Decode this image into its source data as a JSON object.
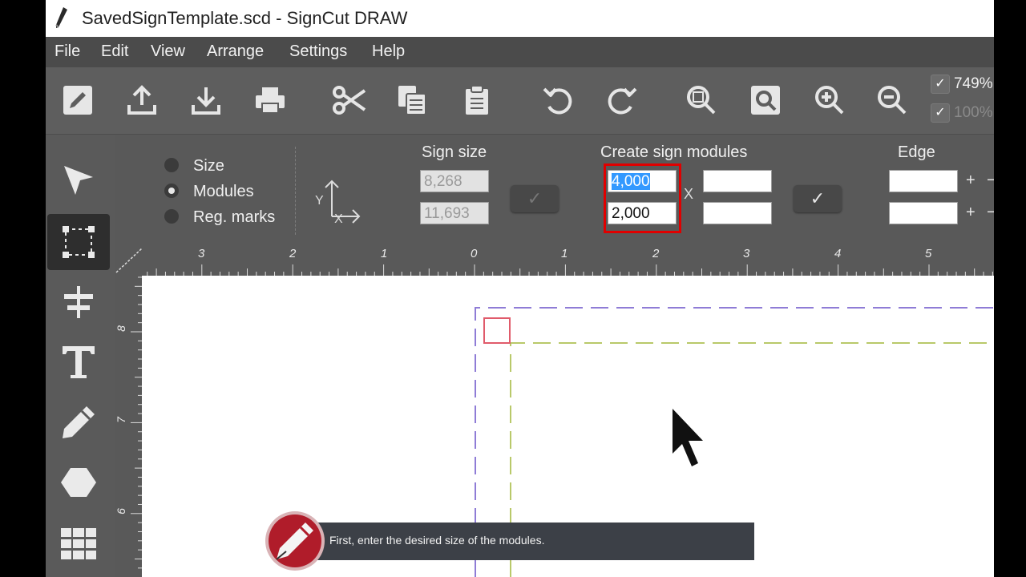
{
  "window": {
    "title": "SavedSignTemplate.scd - SignCut DRAW",
    "app_icon": "pen-icon"
  },
  "menu": [
    "File",
    "Edit",
    "View",
    "Arrange",
    "Settings",
    "Help"
  ],
  "toolbar": {
    "buttons": [
      "edit-icon",
      "export-icon",
      "import-icon",
      "print-icon",
      "cut-icon",
      "copy-icon",
      "paste-icon",
      "undo-icon",
      "redo-icon",
      "zoom-fit-icon",
      "zoom-page-icon",
      "zoom-in-icon",
      "zoom-out-icon"
    ],
    "zoom_primary": "749%",
    "zoom_secondary": "100%"
  },
  "properties": {
    "mode_options": [
      {
        "label": "Size",
        "selected": false
      },
      {
        "label": "Modules",
        "selected": true
      },
      {
        "label": "Reg. marks",
        "selected": false
      }
    ],
    "sign_size": {
      "heading": "Sign size",
      "width": "8,268",
      "height": "11,693",
      "axis_x": "X",
      "axis_y": "Y"
    },
    "modules": {
      "heading": "Create sign modules",
      "width": "4,000",
      "height": "2,000",
      "separator": "X",
      "extra_1": "",
      "extra_2": ""
    },
    "edge": {
      "heading": "Edge",
      "value_1": "",
      "value_2": "",
      "plus": "+",
      "minus": "−"
    },
    "ok_symbol": "✓"
  },
  "tools": [
    "select-arrow-icon",
    "node-edit-icon",
    "align-icon",
    "text-icon",
    "pencil-icon",
    "hexagon-icon",
    "grid-icon"
  ],
  "ruler": {
    "top_labels": [
      "3",
      "2",
      "1",
      "0",
      "1",
      "2",
      "3",
      "4",
      "5"
    ],
    "left_labels": [
      "8",
      "7",
      "6"
    ]
  },
  "colors": {
    "module_outline": "#8f7cd6",
    "edge_outline": "#b9c96a",
    "reg_mark": "#e05b6b",
    "highlight": "#e00000",
    "selection": "#3399ff"
  },
  "tooltip": {
    "text": "First, enter the desired size of the modules."
  }
}
